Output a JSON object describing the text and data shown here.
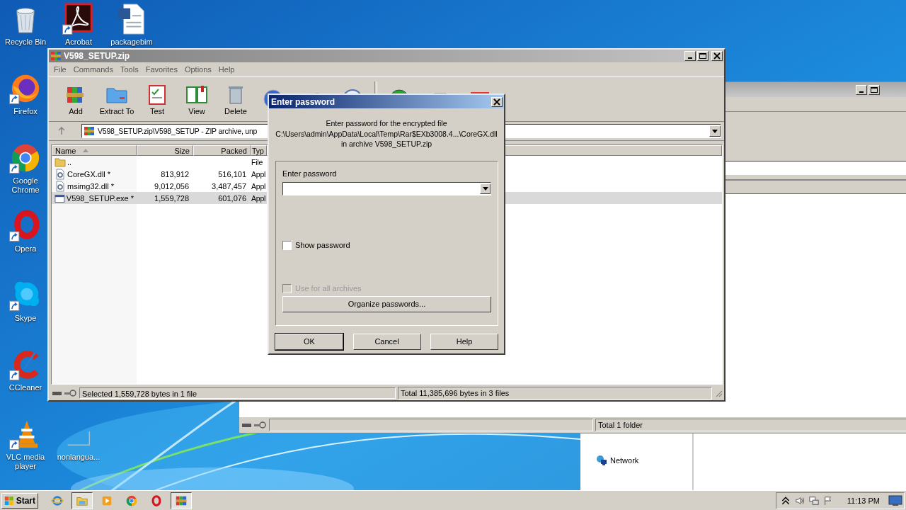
{
  "desktop_icons": [
    {
      "label": "Recycle Bin"
    },
    {
      "label": "Acrobat"
    },
    {
      "label": "packagebim"
    },
    {
      "label": "Firefox"
    },
    {
      "label": "Google Chrome"
    },
    {
      "label": "Opera"
    },
    {
      "label": "Skype"
    },
    {
      "label": "CCleaner"
    },
    {
      "label": "VLC media player"
    },
    {
      "label": "nonlangua..."
    }
  ],
  "explorer_window": {
    "status": "Total 1 folder"
  },
  "nav_pane": {
    "items": [
      {
        "label": "Network"
      }
    ]
  },
  "archive_window": {
    "title": "V598_SETUP.zip",
    "menu": [
      "File",
      "Commands",
      "Tools",
      "Favorites",
      "Options",
      "Help"
    ],
    "toolbar": [
      {
        "label": "Add"
      },
      {
        "label": "Extract To"
      },
      {
        "label": "Test"
      },
      {
        "label": "View"
      },
      {
        "label": "Delete"
      }
    ],
    "address": "V598_SETUP.zip\\V598_SETUP - ZIP archive, unp",
    "columns": [
      {
        "label": "Name",
        "sorted": true
      },
      {
        "label": "Size",
        "sorted": false
      },
      {
        "label": "Packed",
        "sorted": false
      },
      {
        "label": "Typ"
      }
    ],
    "rows": [
      {
        "kind": "folder",
        "name": "..",
        "type": "File",
        "selected": false
      },
      {
        "kind": "library",
        "name": "CoreGX.dll *",
        "size": "813,912",
        "packed": "516,101",
        "type": "Appl",
        "selected": false
      },
      {
        "kind": "library",
        "name": "msimg32.dll *",
        "size": "9,012,056",
        "packed": "3,487,457",
        "type": "Appl",
        "selected": false
      },
      {
        "kind": "program",
        "name": "V598_SETUP.exe *",
        "size": "1,559,728",
        "packed": "601,076",
        "type": "Appl",
        "selected": true
      }
    ],
    "status_left": "Selected 1,559,728 bytes in 1 file",
    "status_right": "Total 11,385,696 bytes in 3 files"
  },
  "dialog": {
    "title": "Enter password",
    "message": [
      "Enter password for the encrypted file",
      "C:\\Users\\admin\\AppData\\Local\\Temp\\Rar$EXb3008.4...\\CoreGX.dll",
      "in archive V598_SETUP.zip"
    ],
    "field_label": "Enter password",
    "checkboxes": [
      {
        "label": "Show password",
        "checked": false,
        "disabled": false
      },
      {
        "label": "Use for all archives",
        "checked": false,
        "disabled": true
      }
    ],
    "organize_button": "Organize passwords...",
    "buttons": [
      {
        "label": "OK",
        "default": true
      },
      {
        "label": "Cancel",
        "default": false
      },
      {
        "label": "Help",
        "default": false
      }
    ]
  },
  "taskbar": {
    "start": "Start",
    "apps": [
      {
        "active": false
      },
      {
        "active": true
      },
      {
        "active": false
      },
      {
        "active": false
      },
      {
        "active": false
      },
      {
        "active": true
      }
    ],
    "clock": "11:13 PM"
  }
}
